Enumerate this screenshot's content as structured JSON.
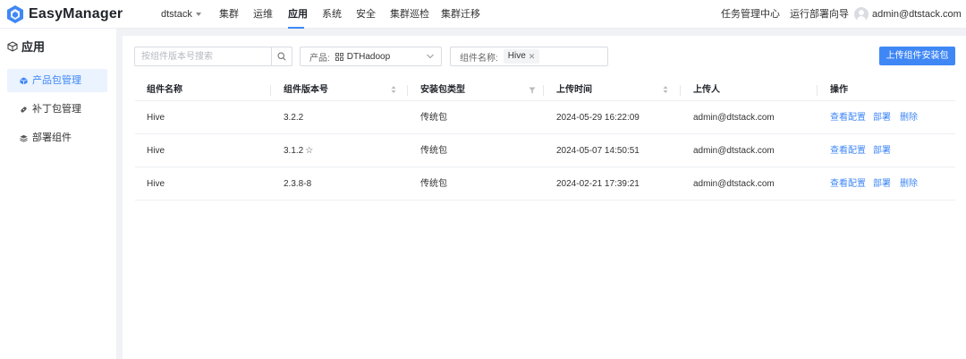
{
  "app": {
    "name": "EasyManager"
  },
  "nav": {
    "tenant": "dtstack",
    "items": [
      "集群",
      "运维",
      "应用",
      "系统",
      "安全",
      "集群巡检",
      "集群迁移"
    ],
    "active": "应用",
    "task_center": "任务管理中心",
    "deploy_wizard": "运行部署向导",
    "user": "admin@dtstack.com"
  },
  "sidebar": {
    "title": "应用",
    "items": [
      {
        "label": "产品包管理",
        "icon": "package-icon",
        "active": true
      },
      {
        "label": "补丁包管理",
        "icon": "patch-icon",
        "active": false
      },
      {
        "label": "部署组件",
        "icon": "layers-icon",
        "active": false
      }
    ]
  },
  "toolbar": {
    "search_placeholder": "按组件版本号搜索",
    "product_label": "产品:",
    "product_value": "DTHadoop",
    "component_label": "组件名称:",
    "component_tag": "Hive",
    "upload_button": "上传组件安装包"
  },
  "table": {
    "columns": [
      "组件名称",
      "组件版本号",
      "安装包类型",
      "上传时间",
      "上传人",
      "操作"
    ],
    "rows": [
      {
        "name": "Hive",
        "version": "3.2.2",
        "type": "传统包",
        "time": "2024-05-29 16:22:09",
        "user": "admin@dtstack.com",
        "star": false,
        "actions": [
          "查看配置",
          "部署",
          "删除"
        ]
      },
      {
        "name": "Hive",
        "version": "3.1.2",
        "type": "传统包",
        "time": "2024-05-07 14:50:51",
        "user": "admin@dtstack.com",
        "star": true,
        "actions": [
          "查看配置",
          "部署"
        ]
      },
      {
        "name": "Hive",
        "version": "2.3.8-8",
        "type": "传统包",
        "time": "2024-02-21 17:39:21",
        "user": "admin@dtstack.com",
        "star": false,
        "actions": [
          "查看配置",
          "部署",
          "删除"
        ]
      }
    ]
  },
  "colors": {
    "accent": "#3f87f5",
    "active_bg": "#eaf3fe",
    "page_bg": "#f0f2f5"
  }
}
